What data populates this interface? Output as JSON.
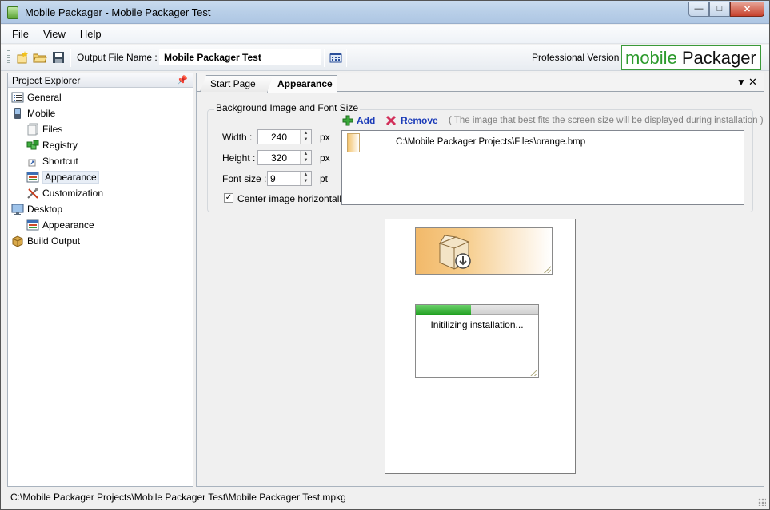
{
  "window": {
    "title": "Mobile Packager - Mobile Packager Test"
  },
  "menu": [
    "File",
    "View",
    "Help"
  ],
  "toolbar": {
    "output_label": "Output File Name :",
    "output_value": "Mobile Packager Test",
    "version_label": "Professional Version",
    "logo_part1": "mobile",
    "logo_part2": "Packager"
  },
  "explorer": {
    "title": "Project Explorer",
    "items": [
      {
        "label": "General",
        "icon": "general-icon",
        "level": 0
      },
      {
        "label": "Mobile",
        "icon": "mobile-device-icon",
        "level": 0
      },
      {
        "label": "Files",
        "icon": "files-icon",
        "level": 1
      },
      {
        "label": "Registry",
        "icon": "registry-icon",
        "level": 1
      },
      {
        "label": "Shortcut",
        "icon": "shortcut-icon",
        "level": 1
      },
      {
        "label": "Appearance",
        "icon": "appearance-icon",
        "level": 1,
        "selected": true
      },
      {
        "label": "Customization",
        "icon": "customization-icon",
        "level": 1
      },
      {
        "label": "Desktop",
        "icon": "desktop-icon",
        "level": 0
      },
      {
        "label": "Appearance",
        "icon": "appearance-icon",
        "level": 1
      },
      {
        "label": "Build Output",
        "icon": "build-output-icon",
        "level": 0
      }
    ]
  },
  "tabs": [
    {
      "label": "Start Page",
      "active": false
    },
    {
      "label": "Appearance",
      "active": true
    }
  ],
  "appearance": {
    "group_title": "Background Image and Font Size",
    "width_label": "Width :",
    "width_value": "240",
    "height_label": "Height :",
    "height_value": "320",
    "font_label": "Font size :",
    "font_value": "9",
    "unit_px": "px",
    "unit_pt": "pt",
    "center_label": "Center image horizontally",
    "center_checked": true,
    "add_label": "Add",
    "remove_label": "Remove",
    "hint": "( The image that best fits the screen size will be displayed during installation )",
    "file_path": "C:\\Mobile Packager Projects\\Files\\orange.bmp"
  },
  "preview": {
    "progress_text": "Initilizing installation...",
    "progress_fraction": 0.45
  },
  "status": {
    "path": "C:\\Mobile Packager Projects\\Mobile Packager Test\\Mobile Packager Test.mpkg"
  },
  "colors": {
    "accent_green": "#2c9a2c",
    "link_blue": "#1b3bb8"
  }
}
